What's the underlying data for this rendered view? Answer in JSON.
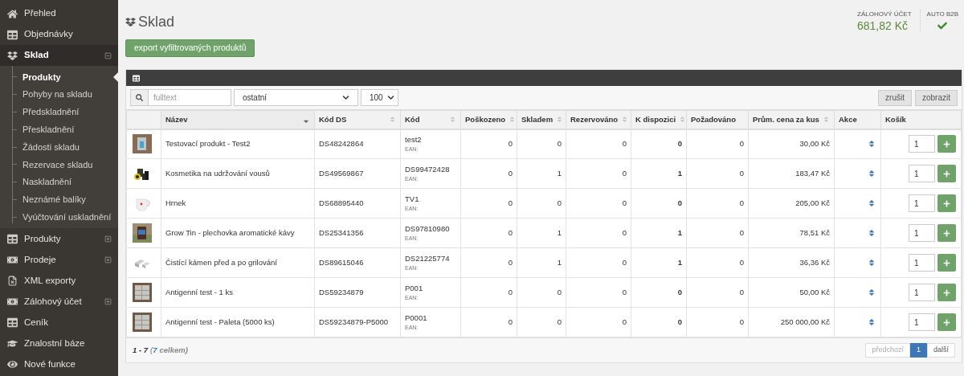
{
  "sidebar": {
    "items": [
      {
        "label": "Přehled",
        "kind": "link"
      },
      {
        "label": "Objednávky",
        "kind": "link"
      },
      {
        "label": "Sklad",
        "kind": "group",
        "expanded": true,
        "children": [
          {
            "label": "Produkty",
            "selected": true
          },
          {
            "label": "Pohyby na skladu",
            "selected": false
          },
          {
            "label": "Předskladnění",
            "selected": false
          },
          {
            "label": "Přeskladnění",
            "selected": false
          },
          {
            "label": "Žádosti skladu",
            "selected": false
          },
          {
            "label": "Rezervace skladu",
            "selected": false
          },
          {
            "label": "Naskladnění",
            "selected": false
          },
          {
            "label": "Neznámé balíky",
            "selected": false
          },
          {
            "label": "Vyúčtování uskladnění",
            "selected": false
          }
        ]
      },
      {
        "label": "Produkty",
        "kind": "group",
        "expanded": false
      },
      {
        "label": "Prodeje",
        "kind": "group",
        "expanded": false
      },
      {
        "label": "XML exporty",
        "kind": "link"
      },
      {
        "label": "Zálohový účet",
        "kind": "group",
        "expanded": false
      },
      {
        "label": "Ceník",
        "kind": "link"
      },
      {
        "label": "Znalostní báze",
        "kind": "link"
      },
      {
        "label": "Nové funkce",
        "kind": "link"
      }
    ]
  },
  "page": {
    "title": "Sklad",
    "export_button": "export vyfiltrovaných produktů"
  },
  "account": {
    "label": "ZÁLOHOVÝ ÚČET",
    "balance": "681,82 Kč"
  },
  "auto_b2b": {
    "label": "AUTO B2B",
    "on": true
  },
  "filters": {
    "search_placeholder": "fulltext",
    "category": "ostatní",
    "page_size": "100",
    "cancel_button": "zrušit",
    "show_button": "zobrazit"
  },
  "table": {
    "columns": [
      {
        "label": "Název",
        "sortable": true,
        "sorted": true
      },
      {
        "label": "Kód DS",
        "sortable": true,
        "sorted": false
      },
      {
        "label": "Kód",
        "sortable": true,
        "sorted": false
      },
      {
        "label": "Poškozeno",
        "sortable": true,
        "sorted": false
      },
      {
        "label": "Skladem",
        "sortable": true,
        "sorted": false
      },
      {
        "label": "Rezervováno",
        "sortable": true,
        "sorted": false
      },
      {
        "label": "K dispozici",
        "sortable": true,
        "sorted": false
      },
      {
        "label": "Požadováno",
        "sortable": false,
        "sorted": false
      },
      {
        "label": "Prům. cena za kus",
        "sortable": true,
        "sorted": false
      },
      {
        "label": "Akce",
        "sortable": false,
        "sorted": false
      },
      {
        "label": "Košík",
        "sortable": false,
        "sorted": false
      }
    ],
    "rows": [
      {
        "name": "Testovací produkt - Test2",
        "ds_code": "DS48242864",
        "code": "test2",
        "ean_label": "EAN:",
        "damaged": "0",
        "in_stock": "0",
        "reserved": "0",
        "available": "0",
        "requested": "0",
        "avg_price": "30,00 Kč",
        "quantity": "1"
      },
      {
        "name": "Kosmetika na udržování vousů",
        "ds_code": "DS49569867",
        "code": "DS99472428",
        "ean_label": "EAN:",
        "damaged": "0",
        "in_stock": "1",
        "reserved": "0",
        "available": "1",
        "requested": "0",
        "avg_price": "183,47 Kč",
        "quantity": "1"
      },
      {
        "name": "Hrnek",
        "ds_code": "DS68895440",
        "code": "TV1",
        "ean_label": "EAN:",
        "damaged": "0",
        "in_stock": "0",
        "reserved": "0",
        "available": "0",
        "requested": "0",
        "avg_price": "205,00 Kč",
        "quantity": "1"
      },
      {
        "name": "Grow Tin - plechovka aromatické kávy",
        "ds_code": "DS25341356",
        "code": "DS97810980",
        "ean_label": "EAN:",
        "damaged": "0",
        "in_stock": "1",
        "reserved": "0",
        "available": "1",
        "requested": "0",
        "avg_price": "78,51 Kč",
        "quantity": "1"
      },
      {
        "name": "Čistící kámen před a po grilování",
        "ds_code": "DS89615046",
        "code": "DS21225774",
        "ean_label": "EAN:",
        "damaged": "0",
        "in_stock": "1",
        "reserved": "0",
        "available": "1",
        "requested": "0",
        "avg_price": "36,36 Kč",
        "quantity": "1"
      },
      {
        "name": "Antigenní test - 1 ks",
        "ds_code": "DS59234879",
        "code": "P001",
        "ean_label": "EAN:",
        "damaged": "0",
        "in_stock": "0",
        "reserved": "0",
        "available": "0",
        "requested": "0",
        "avg_price": "50,00 Kč",
        "quantity": "1"
      },
      {
        "name": "Antigenní test - Paleta (5000 ks)",
        "ds_code": "DS59234879-P5000",
        "code": "P0001",
        "ean_label": "EAN:",
        "damaged": "0",
        "in_stock": "0",
        "reserved": "0",
        "available": "0",
        "requested": "0",
        "avg_price": "250 000,00 Kč",
        "quantity": "1"
      }
    ]
  },
  "footer": {
    "range": "1 - 7",
    "total_open": "(",
    "total": "7",
    "total_close": "celkem)"
  },
  "pagination": [
    {
      "label": "předchozí",
      "disabled": true,
      "selected": false
    },
    {
      "label": "1",
      "disabled": false,
      "selected": true
    },
    {
      "label": "další",
      "disabled": false,
      "selected": false
    }
  ]
}
